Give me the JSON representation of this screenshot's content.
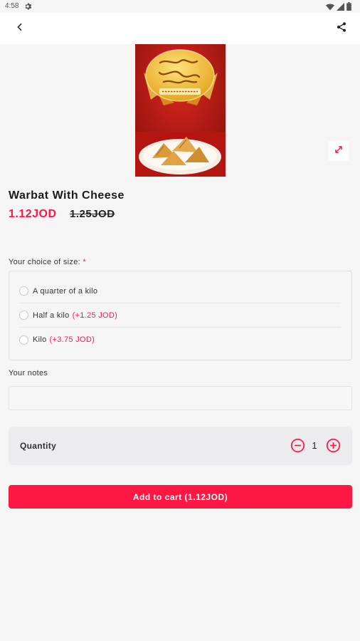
{
  "status_bar": {
    "time": "4:58"
  },
  "product": {
    "title": "Warbat With Cheese",
    "price": "1.12JOD",
    "old_price": "1.25JOD"
  },
  "size": {
    "label": "Your choice of size:",
    "required_marker": "*",
    "options": [
      {
        "label": "A quarter of a kilo",
        "extra": ""
      },
      {
        "label": "Half a kilo",
        "extra": "(+1.25 JOD)"
      },
      {
        "label": "Kilo",
        "extra": "(+3.75 JOD)"
      }
    ]
  },
  "notes": {
    "label": "Your notes",
    "value": "",
    "placeholder": ""
  },
  "quantity": {
    "label": "Quantity",
    "value": "1"
  },
  "cart": {
    "button_label": "Add to cart (1.12JOD)"
  },
  "colors": {
    "accent": "#ff1744",
    "background": "#f5f5f5"
  }
}
